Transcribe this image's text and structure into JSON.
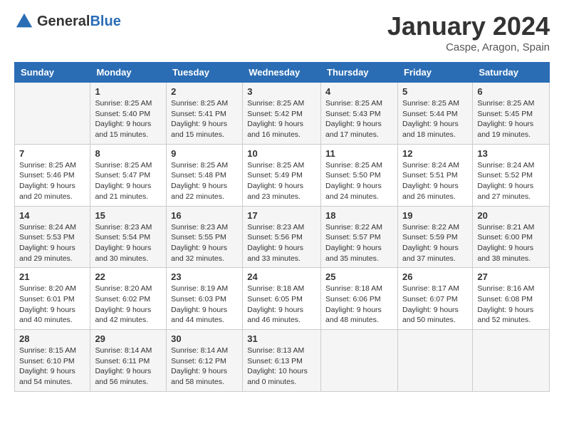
{
  "logo": {
    "general": "General",
    "blue": "Blue"
  },
  "title": "January 2024",
  "location": "Caspe, Aragon, Spain",
  "days_header": [
    "Sunday",
    "Monday",
    "Tuesday",
    "Wednesday",
    "Thursday",
    "Friday",
    "Saturday"
  ],
  "weeks": [
    [
      {
        "day": "",
        "info": ""
      },
      {
        "day": "1",
        "info": "Sunrise: 8:25 AM\nSunset: 5:40 PM\nDaylight: 9 hours\nand 15 minutes."
      },
      {
        "day": "2",
        "info": "Sunrise: 8:25 AM\nSunset: 5:41 PM\nDaylight: 9 hours\nand 15 minutes."
      },
      {
        "day": "3",
        "info": "Sunrise: 8:25 AM\nSunset: 5:42 PM\nDaylight: 9 hours\nand 16 minutes."
      },
      {
        "day": "4",
        "info": "Sunrise: 8:25 AM\nSunset: 5:43 PM\nDaylight: 9 hours\nand 17 minutes."
      },
      {
        "day": "5",
        "info": "Sunrise: 8:25 AM\nSunset: 5:44 PM\nDaylight: 9 hours\nand 18 minutes."
      },
      {
        "day": "6",
        "info": "Sunrise: 8:25 AM\nSunset: 5:45 PM\nDaylight: 9 hours\nand 19 minutes."
      }
    ],
    [
      {
        "day": "7",
        "info": "Sunrise: 8:25 AM\nSunset: 5:46 PM\nDaylight: 9 hours\nand 20 minutes."
      },
      {
        "day": "8",
        "info": "Sunrise: 8:25 AM\nSunset: 5:47 PM\nDaylight: 9 hours\nand 21 minutes."
      },
      {
        "day": "9",
        "info": "Sunrise: 8:25 AM\nSunset: 5:48 PM\nDaylight: 9 hours\nand 22 minutes."
      },
      {
        "day": "10",
        "info": "Sunrise: 8:25 AM\nSunset: 5:49 PM\nDaylight: 9 hours\nand 23 minutes."
      },
      {
        "day": "11",
        "info": "Sunrise: 8:25 AM\nSunset: 5:50 PM\nDaylight: 9 hours\nand 24 minutes."
      },
      {
        "day": "12",
        "info": "Sunrise: 8:24 AM\nSunset: 5:51 PM\nDaylight: 9 hours\nand 26 minutes."
      },
      {
        "day": "13",
        "info": "Sunrise: 8:24 AM\nSunset: 5:52 PM\nDaylight: 9 hours\nand 27 minutes."
      }
    ],
    [
      {
        "day": "14",
        "info": "Sunrise: 8:24 AM\nSunset: 5:53 PM\nDaylight: 9 hours\nand 29 minutes."
      },
      {
        "day": "15",
        "info": "Sunrise: 8:23 AM\nSunset: 5:54 PM\nDaylight: 9 hours\nand 30 minutes."
      },
      {
        "day": "16",
        "info": "Sunrise: 8:23 AM\nSunset: 5:55 PM\nDaylight: 9 hours\nand 32 minutes."
      },
      {
        "day": "17",
        "info": "Sunrise: 8:23 AM\nSunset: 5:56 PM\nDaylight: 9 hours\nand 33 minutes."
      },
      {
        "day": "18",
        "info": "Sunrise: 8:22 AM\nSunset: 5:57 PM\nDaylight: 9 hours\nand 35 minutes."
      },
      {
        "day": "19",
        "info": "Sunrise: 8:22 AM\nSunset: 5:59 PM\nDaylight: 9 hours\nand 37 minutes."
      },
      {
        "day": "20",
        "info": "Sunrise: 8:21 AM\nSunset: 6:00 PM\nDaylight: 9 hours\nand 38 minutes."
      }
    ],
    [
      {
        "day": "21",
        "info": "Sunrise: 8:20 AM\nSunset: 6:01 PM\nDaylight: 9 hours\nand 40 minutes."
      },
      {
        "day": "22",
        "info": "Sunrise: 8:20 AM\nSunset: 6:02 PM\nDaylight: 9 hours\nand 42 minutes."
      },
      {
        "day": "23",
        "info": "Sunrise: 8:19 AM\nSunset: 6:03 PM\nDaylight: 9 hours\nand 44 minutes."
      },
      {
        "day": "24",
        "info": "Sunrise: 8:18 AM\nSunset: 6:05 PM\nDaylight: 9 hours\nand 46 minutes."
      },
      {
        "day": "25",
        "info": "Sunrise: 8:18 AM\nSunset: 6:06 PM\nDaylight: 9 hours\nand 48 minutes."
      },
      {
        "day": "26",
        "info": "Sunrise: 8:17 AM\nSunset: 6:07 PM\nDaylight: 9 hours\nand 50 minutes."
      },
      {
        "day": "27",
        "info": "Sunrise: 8:16 AM\nSunset: 6:08 PM\nDaylight: 9 hours\nand 52 minutes."
      }
    ],
    [
      {
        "day": "28",
        "info": "Sunrise: 8:15 AM\nSunset: 6:10 PM\nDaylight: 9 hours\nand 54 minutes."
      },
      {
        "day": "29",
        "info": "Sunrise: 8:14 AM\nSunset: 6:11 PM\nDaylight: 9 hours\nand 56 minutes."
      },
      {
        "day": "30",
        "info": "Sunrise: 8:14 AM\nSunset: 6:12 PM\nDaylight: 9 hours\nand 58 minutes."
      },
      {
        "day": "31",
        "info": "Sunrise: 8:13 AM\nSunset: 6:13 PM\nDaylight: 10 hours\nand 0 minutes."
      },
      {
        "day": "",
        "info": ""
      },
      {
        "day": "",
        "info": ""
      },
      {
        "day": "",
        "info": ""
      }
    ]
  ]
}
